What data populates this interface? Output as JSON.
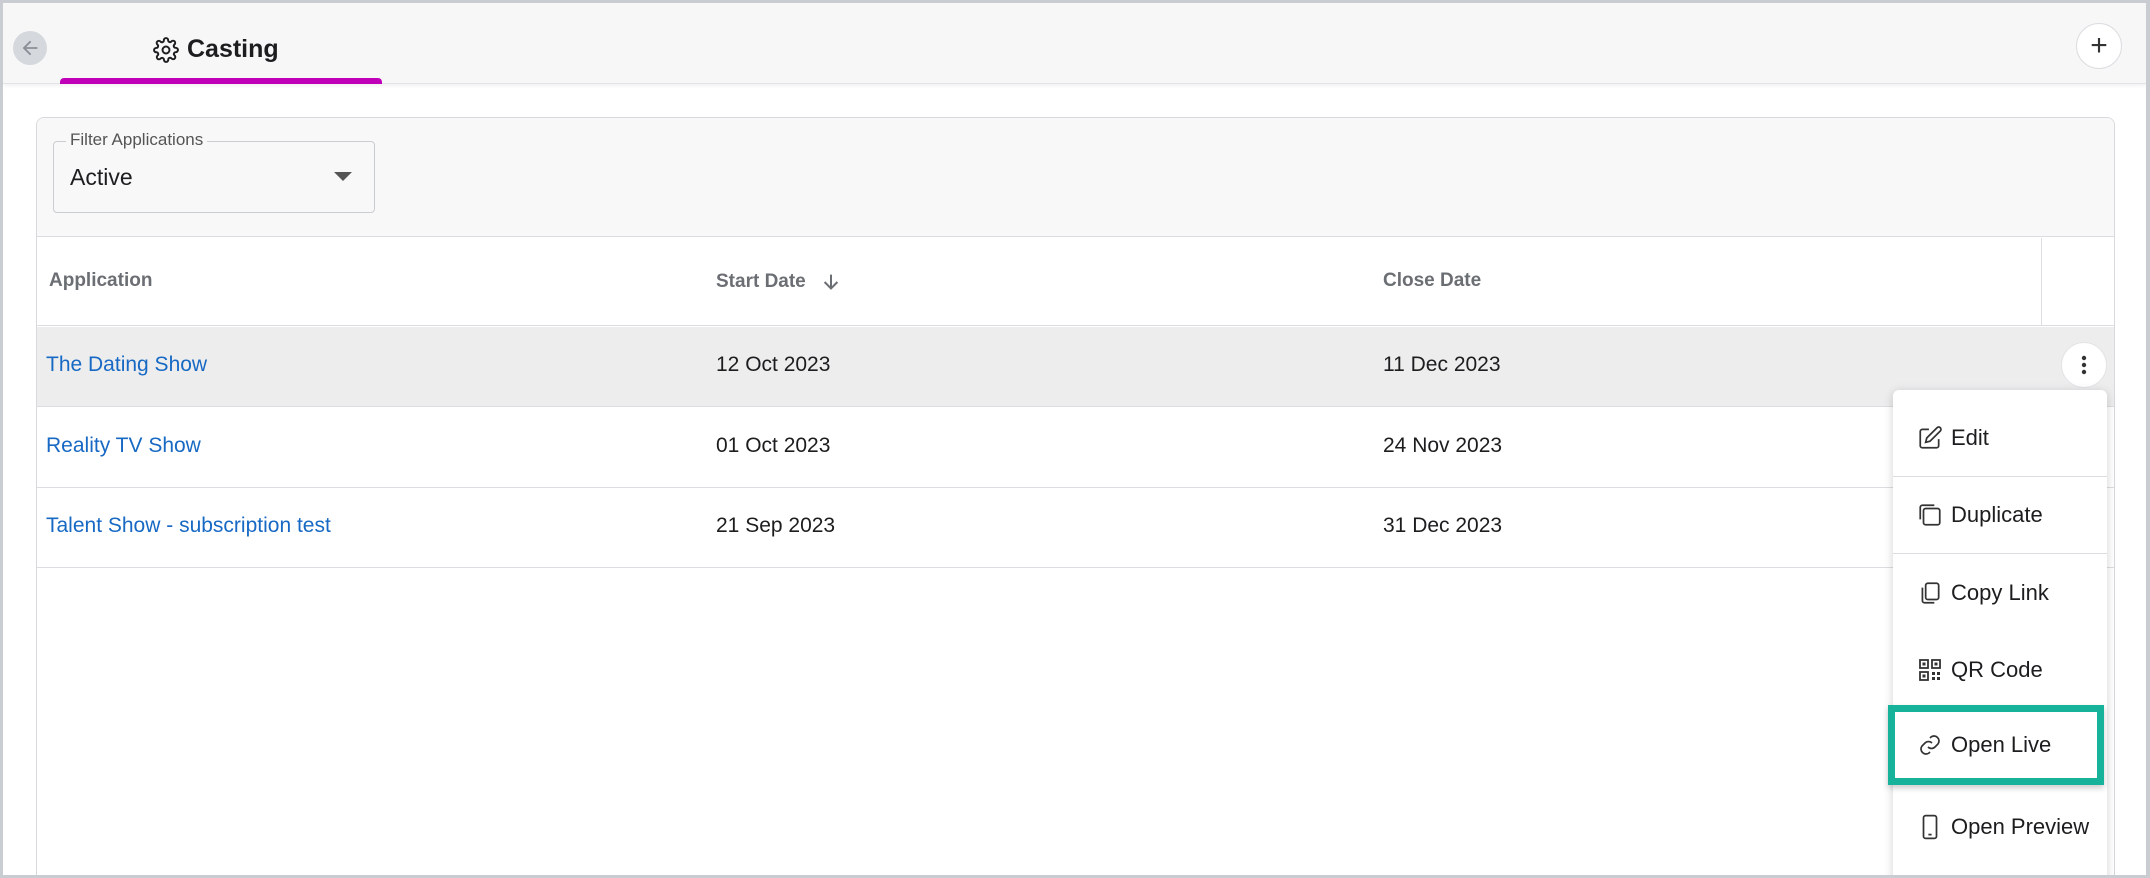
{
  "header": {
    "tab_title": "Casting",
    "add_symbol": "+"
  },
  "filter": {
    "legend": "Filter Applications",
    "value": "Active"
  },
  "table": {
    "columns": [
      "Application",
      "Start Date",
      "Close Date"
    ],
    "sort_column": "Start Date",
    "sort_direction": "descending",
    "rows": [
      {
        "application": "The Dating Show",
        "start": "12 Oct 2023",
        "close": "11 Dec 2023"
      },
      {
        "application": "Reality TV Show",
        "start": "01 Oct 2023",
        "close": "24 Nov 2023"
      },
      {
        "application": "Talent Show - subscription test",
        "start": "21 Sep 2023",
        "close": "31 Dec 2023"
      }
    ]
  },
  "menu": {
    "items": [
      {
        "label": "Edit",
        "icon": "edit-icon"
      },
      {
        "label": "Duplicate",
        "icon": "duplicate-icon"
      },
      {
        "label": "Copy Link",
        "icon": "copy-icon"
      },
      {
        "label": "QR Code",
        "icon": "qr-code-icon"
      },
      {
        "label": "Open Live",
        "icon": "link-icon"
      },
      {
        "label": "Open Preview",
        "icon": "phone-icon"
      }
    ],
    "highlight_color": "#16b39a"
  },
  "colors": {
    "accent_tab": "#c000b8",
    "link": "#1769c4"
  }
}
